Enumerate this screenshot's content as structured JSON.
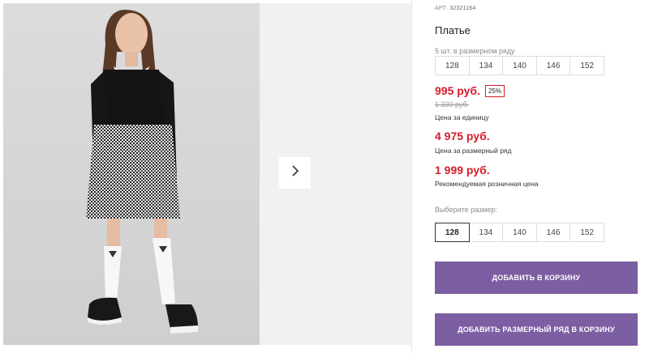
{
  "product": {
    "article_label": "АРТ:",
    "article_number": "32321164",
    "title": "Платье",
    "pack_note": "5 шт. в размерном ряду"
  },
  "pack_sizes": [
    "128",
    "134",
    "140",
    "146",
    "152"
  ],
  "pricing": {
    "unit_price": "995 руб.",
    "discount": "25%",
    "old_price": "1 330 руб.",
    "unit_label": "Цена за единицу",
    "range_price": "4 975 руб.",
    "range_label": "Цена за размерный ряд",
    "rrp_price": "1 999 руб.",
    "rrp_label": "Рекомендуемая розничная цена"
  },
  "size_picker": {
    "label": "Выберите размер:",
    "options": [
      "128",
      "134",
      "140",
      "146",
      "152"
    ],
    "selected": "128"
  },
  "buttons": {
    "add_to_cart": "ДОБАВИТЬ В КОРЗИНУ",
    "add_range_to_cart": "ДОБАВИТЬ РАЗМЕРНЫЙ РЯД В КОРЗИНУ"
  },
  "colors": {
    "price_red": "#d41c2a",
    "button_purple": "#7c5ea2"
  },
  "icons": {
    "gallery_next": "chevron-right-icon"
  }
}
